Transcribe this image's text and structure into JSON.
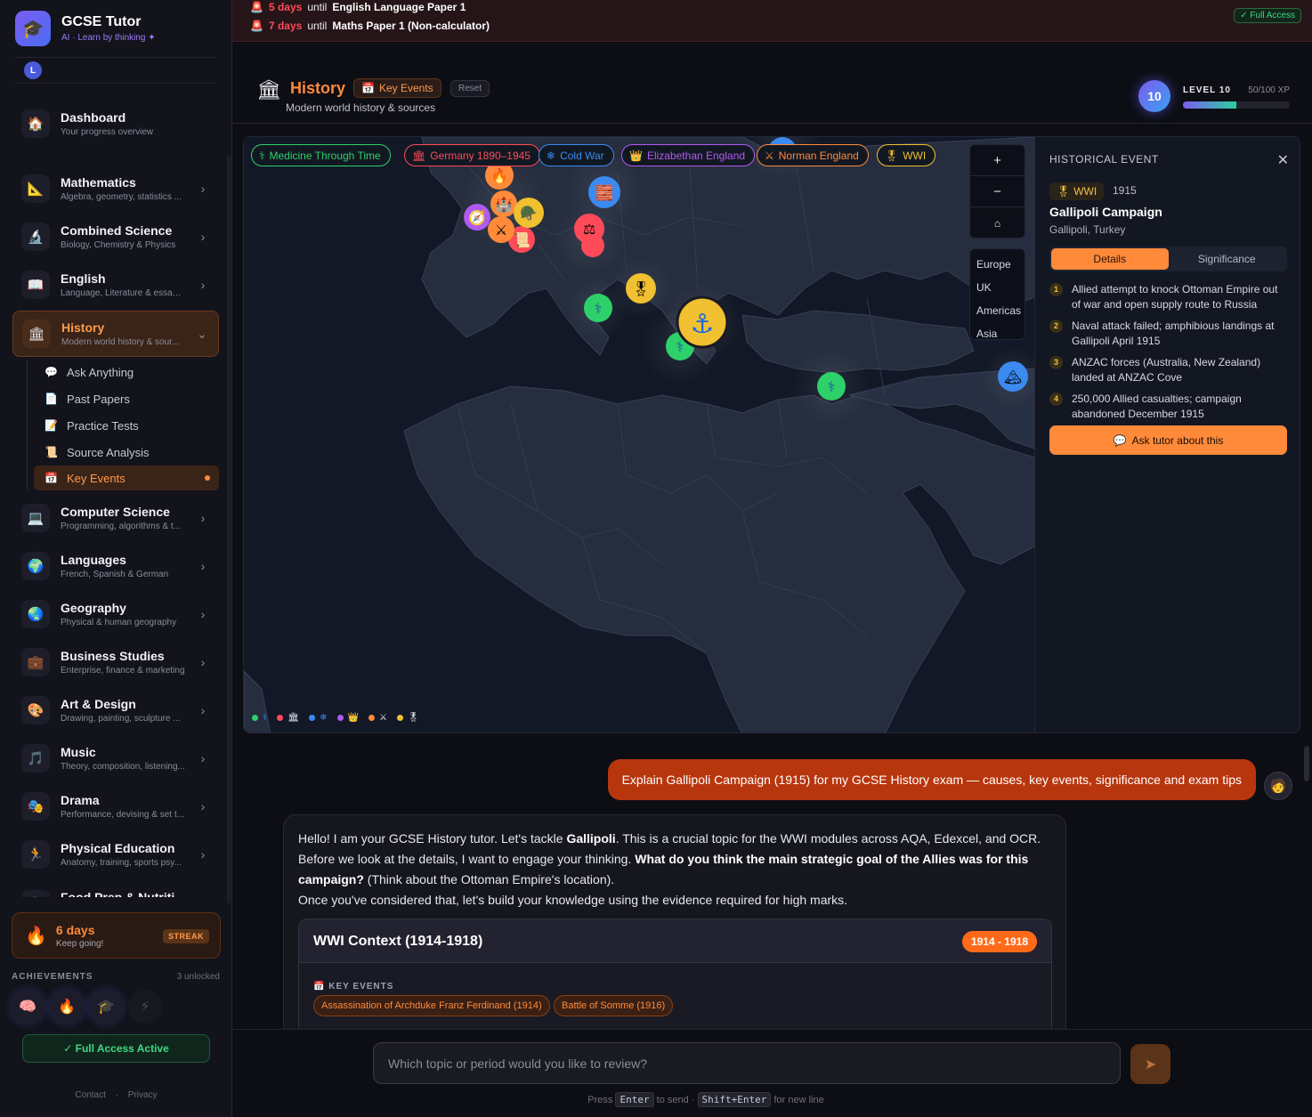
{
  "brand": {
    "title": "GCSE Tutor",
    "subtitle": "AI · Learn by thinking ✦",
    "avatar_letter": "L"
  },
  "banner": {
    "rows": [
      {
        "count": "5 days",
        "text": "until",
        "exam": "English Language Paper 1"
      },
      {
        "count": "7 days",
        "text": "until",
        "exam": "Maths Paper 1 (Non-calculator)"
      }
    ],
    "access_pill": "✓ Full Access"
  },
  "sidebar": {
    "dashboard": {
      "label": "Dashboard",
      "sub": "Your progress overview"
    },
    "subjects": [
      {
        "label": "Mathematics",
        "sub": "Algebra, geometry, statistics ..."
      },
      {
        "label": "Combined Science",
        "sub": "Biology, Chemistry & Physics"
      },
      {
        "label": "English",
        "sub": "Language, Literature & essay ..."
      },
      {
        "label": "History",
        "sub": "Modern world history & sour..."
      },
      {
        "label": "Computer Science",
        "sub": "Programming, algorithms & t..."
      },
      {
        "label": "Languages",
        "sub": "French, Spanish & German"
      },
      {
        "label": "Geography",
        "sub": "Physical & human geography"
      },
      {
        "label": "Business Studies",
        "sub": "Enterprise, finance & marketing"
      },
      {
        "label": "Art & Design",
        "sub": "Drawing, painting, sculpture ..."
      },
      {
        "label": "Music",
        "sub": "Theory, composition, listening..."
      },
      {
        "label": "Drama",
        "sub": "Performance, devising & set t..."
      },
      {
        "label": "Physical Education",
        "sub": "Anatomy, training, sports psy..."
      },
      {
        "label": "Food Prep & Nutriti",
        "sub": ""
      }
    ],
    "history_sub": [
      {
        "label": "Ask Anything"
      },
      {
        "label": "Past Papers"
      },
      {
        "label": "Practice Tests"
      },
      {
        "label": "Source Analysis"
      },
      {
        "label": "Key Events"
      }
    ],
    "streak": {
      "days": "6 days",
      "sub": "Keep going!",
      "badge": "STREAK"
    },
    "achievements": {
      "title": "ACHIEVEMENTS",
      "count": "3 unlocked"
    },
    "full_access_btn": "✓ Full Access Active",
    "footer": {
      "contact": "Contact",
      "sep": "·",
      "privacy": "Privacy"
    }
  },
  "header": {
    "title": "History",
    "subtitle": "Modern world history & sources",
    "badge": "Key Events",
    "reset": "Reset",
    "level_num": "10",
    "level_label": "LEVEL 10",
    "xp": "50/100 XP",
    "xp_progress": 0.5
  },
  "map": {
    "chips": [
      {
        "label": "Medicine Through Time",
        "color": "#2ed06a"
      },
      {
        "label": "Germany 1890–1945",
        "color": "#ff4a5a"
      },
      {
        "label": "Cold War",
        "color": "#3a8af0"
      },
      {
        "label": "Elizabethan England",
        "color": "#b05af0"
      },
      {
        "label": "Norman England",
        "color": "#ff8a3a"
      },
      {
        "label": "WWI",
        "color": "#f0c030"
      }
    ],
    "zoom": {
      "in": "+",
      "out": "−",
      "home": "⌂"
    },
    "regions": [
      "Europe",
      "UK",
      "Americas",
      "Asia"
    ]
  },
  "event": {
    "panel_title": "HISTORICAL EVENT",
    "tag": "WWI",
    "year": "1915",
    "name": "Gallipoli Campaign",
    "location": "Gallipoli, Turkey",
    "tabs": [
      "Details",
      "Significance"
    ],
    "details": [
      "Allied attempt to knock Ottoman Empire out of war and open supply route to Russia",
      "Naval attack failed; amphibious landings at Gallipoli April 1915",
      "ANZAC forces (Australia, New Zealand) landed at ANZAC Cove",
      "250,000 Allied casualties; campaign abandoned December 1915"
    ],
    "ask_btn": "Ask tutor about this"
  },
  "chat": {
    "user_msg": "Explain Gallipoli Campaign (1915) for my GCSE History exam — causes, key events, significance and exam tips",
    "bot": {
      "p1a": "Hello! I am your GCSE History tutor. Let's tackle ",
      "p1b": "Gallipoli",
      "p1c": ". This is a crucial topic for the WWI modules across AQA, Edexcel, and OCR.",
      "p2a": "Before we look at the details, I want to engage your thinking. ",
      "p2b": "What do you think the main strategic goal of the Allies was for this campaign?",
      "p2c": " (Think about the Ottoman Empire's location).",
      "p3": "Once you've considered that, let's build your knowledge using the evidence required for high marks."
    },
    "context": {
      "title": "WWI Context (1914-1918)",
      "range": "1914 - 1918",
      "label": "KEY EVENTS",
      "events": [
        "Assassination of Archduke Franz Ferdinand (1914)",
        "Battle of Somme (1916)"
      ]
    }
  },
  "input": {
    "placeholder": "Which topic or period would you like to review?",
    "hint_press": "Press",
    "hint_enter": "Enter",
    "hint_send": "to send ·",
    "hint_shift": "Shift+Enter",
    "hint_newline": "for new line"
  }
}
